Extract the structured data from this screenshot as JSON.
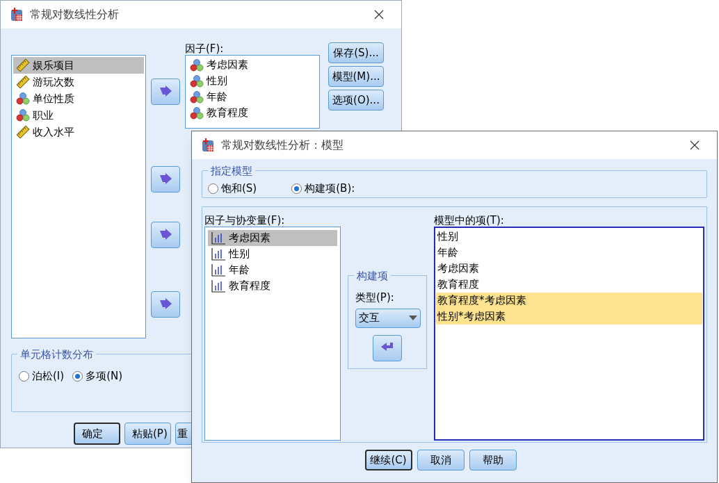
{
  "main_dialog": {
    "title": "常规对数线性分析",
    "variables": [
      {
        "label": "娱乐项目",
        "kind": "scale",
        "selected": true
      },
      {
        "label": "游玩次数",
        "kind": "scale",
        "selected": false
      },
      {
        "label": "单位性质",
        "kind": "nominal",
        "selected": false
      },
      {
        "label": "职业",
        "kind": "nominal",
        "selected": false
      },
      {
        "label": "收入水平",
        "kind": "scale",
        "selected": false
      }
    ],
    "factors_label": "因子(F):",
    "factors": [
      {
        "label": "考虑因素",
        "kind": "nominal"
      },
      {
        "label": "性别",
        "kind": "nominal"
      },
      {
        "label": "年龄",
        "kind": "nominal"
      },
      {
        "label": "教育程度",
        "kind": "nominal"
      }
    ],
    "side_buttons": [
      "保存(S)...",
      "模型(M)...",
      "选项(O)..."
    ],
    "distribution": {
      "title": "单元格计数分布",
      "options": [
        {
          "label": "泊松(I)",
          "selected": false
        },
        {
          "label": "多项(N)",
          "selected": true
        }
      ]
    },
    "buttons": [
      {
        "label": "确定",
        "default": true
      },
      {
        "label": "粘贴(P)",
        "default": false
      },
      {
        "label": "重",
        "default": false
      }
    ]
  },
  "model_dialog": {
    "title": "常规对数线性分析：模型",
    "specify": {
      "title": "指定模型",
      "options": [
        {
          "label": "饱和(S)",
          "selected": false
        },
        {
          "label": "构建项(B):",
          "selected": true
        }
      ]
    },
    "factors_label": "因子与协变量(F):",
    "factors": [
      {
        "label": "考虑因素",
        "selected": true
      },
      {
        "label": "性别",
        "selected": false
      },
      {
        "label": "年龄",
        "selected": false
      },
      {
        "label": "教育程度",
        "selected": false
      }
    ],
    "build": {
      "title": "构建项",
      "type_label": "类型(P):",
      "type_value": "交互"
    },
    "terms_label": "模型中的项(T):",
    "terms": [
      {
        "label": "性别",
        "selected": false
      },
      {
        "label": "年龄",
        "selected": false
      },
      {
        "label": "考虑因素",
        "selected": false
      },
      {
        "label": "教育程度",
        "selected": false
      },
      {
        "label": "教育程度*考虑因素",
        "selected": true
      },
      {
        "label": "性别*考虑因素",
        "selected": true
      }
    ],
    "buttons": [
      {
        "label": "继续(C)",
        "default": true
      },
      {
        "label": "取消",
        "default": false
      },
      {
        "label": "帮助",
        "default": false
      }
    ]
  }
}
